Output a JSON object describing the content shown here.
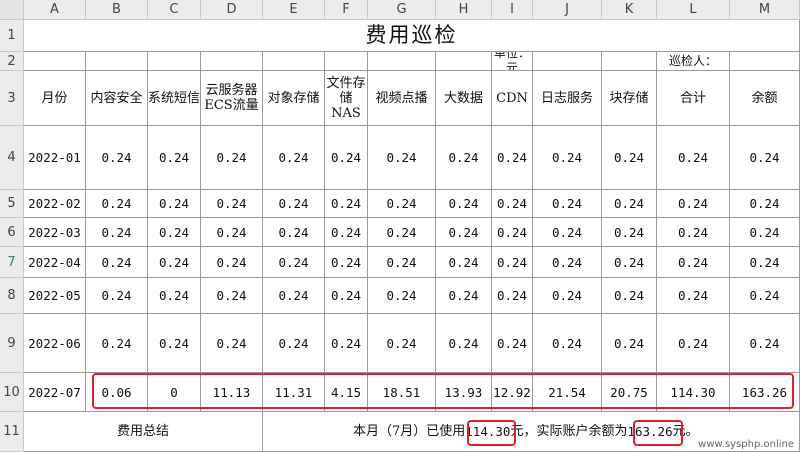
{
  "columns": [
    "A",
    "B",
    "C",
    "D",
    "E",
    "F",
    "G",
    "H",
    "I",
    "J",
    "K",
    "L",
    "M"
  ],
  "rows": [
    "1",
    "2",
    "3",
    "4",
    "5",
    "6",
    "7",
    "8",
    "9",
    "10",
    "11"
  ],
  "active_row": "7",
  "title": "费用巡检",
  "unit_label": "单位：元",
  "inspector_label": "巡检人：",
  "headers": [
    "月份",
    "内容安全",
    "系统短信",
    "云服务器ECS流量",
    "对象存储",
    "文件存储NAS",
    "视频点播",
    "大数据",
    "CDN",
    "日志服务",
    "块存储",
    "合计",
    "余额"
  ],
  "data_rows": [
    [
      "2022-01",
      "0.24",
      "0.24",
      "0.24",
      "0.24",
      "0.24",
      "0.24",
      "0.24",
      "0.24",
      "0.24",
      "0.24",
      "0.24",
      "0.24"
    ],
    [
      "2022-02",
      "0.24",
      "0.24",
      "0.24",
      "0.24",
      "0.24",
      "0.24",
      "0.24",
      "0.24",
      "0.24",
      "0.24",
      "0.24",
      "0.24"
    ],
    [
      "2022-03",
      "0.24",
      "0.24",
      "0.24",
      "0.24",
      "0.24",
      "0.24",
      "0.24",
      "0.24",
      "0.24",
      "0.24",
      "0.24",
      "0.24"
    ],
    [
      "2022-04",
      "0.24",
      "0.24",
      "0.24",
      "0.24",
      "0.24",
      "0.24",
      "0.24",
      "0.24",
      "0.24",
      "0.24",
      "0.24",
      "0.24"
    ],
    [
      "2022-05",
      "0.24",
      "0.24",
      "0.24",
      "0.24",
      "0.24",
      "0.24",
      "0.24",
      "0.24",
      "0.24",
      "0.24",
      "0.24",
      "0.24"
    ],
    [
      "2022-06",
      "0.24",
      "0.24",
      "0.24",
      "0.24",
      "0.24",
      "0.24",
      "0.24",
      "0.24",
      "0.24",
      "0.24",
      "0.24",
      "0.24"
    ],
    [
      "2022-07",
      "0.06",
      "0",
      "11.13",
      "11.31",
      "4.15",
      "18.51",
      "13.93",
      "12.92",
      "21.54",
      "20.75",
      "114.30",
      "163.26"
    ]
  ],
  "summary": {
    "label": "费用总结",
    "text_1": "本月（7月）已使用",
    "used": "114.30",
    "text_2": "元，实际账户余额为",
    "balance": "163.26",
    "text_3": "元。"
  },
  "watermark": "www.sysphp.online",
  "highlight_color": "#e0202a"
}
